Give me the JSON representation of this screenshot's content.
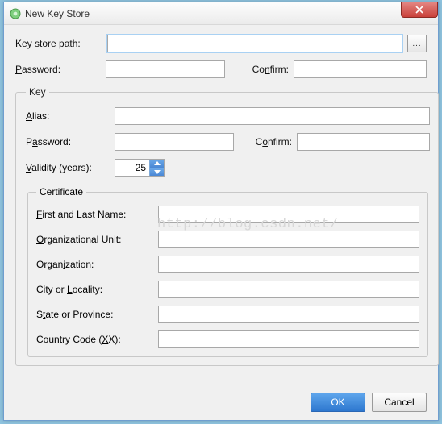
{
  "window": {
    "title": "New Key Store"
  },
  "form": {
    "keystore_path_label": "Key store path:",
    "keystore_path_value": "",
    "browse_label": "...",
    "password_label": "Password:",
    "password_value": "",
    "confirm_label": "Confirm:",
    "confirm_value": ""
  },
  "key": {
    "legend": "Key",
    "alias_label": "Alias:",
    "alias_value": "",
    "password_label": "Password:",
    "password_value": "",
    "confirm_label": "Confirm:",
    "confirm_value": "",
    "validity_label": "Validity (years):",
    "validity_value": "25"
  },
  "cert": {
    "legend": "Certificate",
    "first_last_label": "First and Last Name:",
    "first_last_value": "",
    "org_unit_label": "Organizational Unit:",
    "org_unit_value": "",
    "organization_label": "Organization:",
    "organization_value": "",
    "city_label": "City or Locality:",
    "city_value": "",
    "state_label": "State or Province:",
    "state_value": "",
    "country_label": "Country Code (XX):",
    "country_value": ""
  },
  "buttons": {
    "ok": "OK",
    "cancel": "Cancel"
  },
  "watermark": "http://blog.csdn.net/"
}
